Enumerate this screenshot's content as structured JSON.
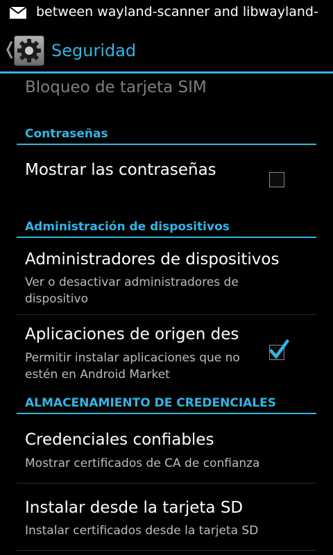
{
  "status_bar": {
    "notification_icon": "mail-icon",
    "ticker_text": "between wayland-scanner and  libwayland-"
  },
  "action_bar": {
    "back_icon": "chevron-left-icon",
    "app_icon": "settings-gear-icon",
    "title": "Seguridad"
  },
  "sim_lock": {
    "title": "Bloqueo de tarjeta SIM"
  },
  "passwords": {
    "category": "Contraseñas",
    "show_passwords": {
      "title": "Mostrar las contraseñas",
      "checked": false
    }
  },
  "device_admin": {
    "category": "Administración de dispositivos",
    "administrators": {
      "title": "Administradores de dispositivos",
      "summary": "Ver o desactivar administradores de dispositivo"
    },
    "unknown_sources": {
      "title": "Aplicaciones de origen des",
      "summary": "Permitir instalar aplicaciones que no estén en Android Market",
      "checked": true
    }
  },
  "credentials": {
    "category": "ALMACENAMIENTO DE CREDENCIALES",
    "trusted": {
      "title": "Credenciales confiables",
      "summary": "Mostrar certificados de CA de confianza"
    },
    "install_sd": {
      "title": "Instalar desde la tarjeta SD",
      "summary": "Instalar certificados desde la tarjeta SD"
    }
  },
  "colors": {
    "accent": "#33b5e5",
    "background": "#000000"
  }
}
